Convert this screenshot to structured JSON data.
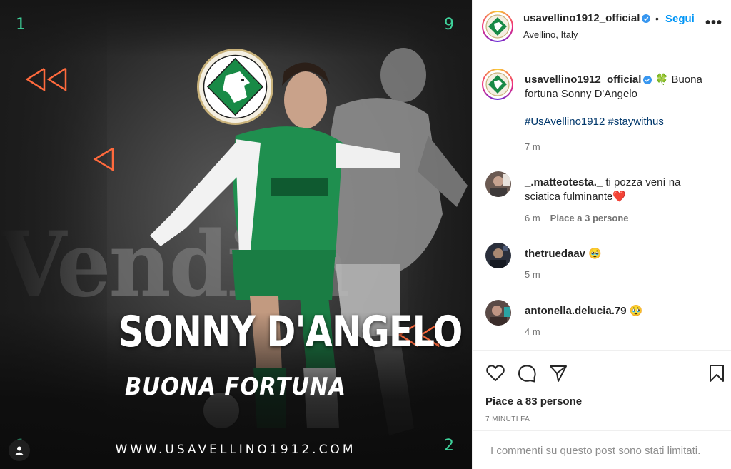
{
  "post_image": {
    "headline": "SONNY D'ANGELO",
    "subline": "BUONA FORTUNA",
    "website": "WWW.USAVELLINO1912.COM",
    "background_word": "Vendita",
    "corner_numbers": {
      "top_left": "1",
      "top_right": "9",
      "bottom_left": "1",
      "bottom_right": "2"
    },
    "accent_color": "#ff6a3d",
    "number_color": "#3fd29b",
    "crest_icon": "us-avellino-wolf-crest"
  },
  "header": {
    "username": "usavellino1912_official",
    "follow_label": "Segui",
    "location": "Avellino, Italy",
    "more_icon": "more-dots-icon"
  },
  "caption": {
    "username": "usavellino1912_official",
    "text": "🍀 Buona fortuna Sonny D'Angelo",
    "hashtags": [
      "#UsAvellino1912",
      "#staywithus"
    ],
    "time": "7 m"
  },
  "comments": [
    {
      "username": "_.matteotesta._",
      "text": "ti pozza venì na sciatica fulminante❤️",
      "time": "6 m",
      "likes": "Piace a 3 persone"
    },
    {
      "username": "thetruedaav",
      "text": "🥹",
      "time": "5 m",
      "likes": ""
    },
    {
      "username": "antonella.delucia.79",
      "text": "🥹",
      "time": "4 m",
      "likes": ""
    }
  ],
  "footer": {
    "likes_total": "Piace a 83 persone",
    "post_age": "7 MINUTI FA",
    "comments_limited": "I commenti su questo post sono stati limitati."
  },
  "colors": {
    "link_blue": "#0095f6",
    "hashtag_blue": "#00376b",
    "muted": "#737373",
    "verified_blue": "#3897f0"
  }
}
